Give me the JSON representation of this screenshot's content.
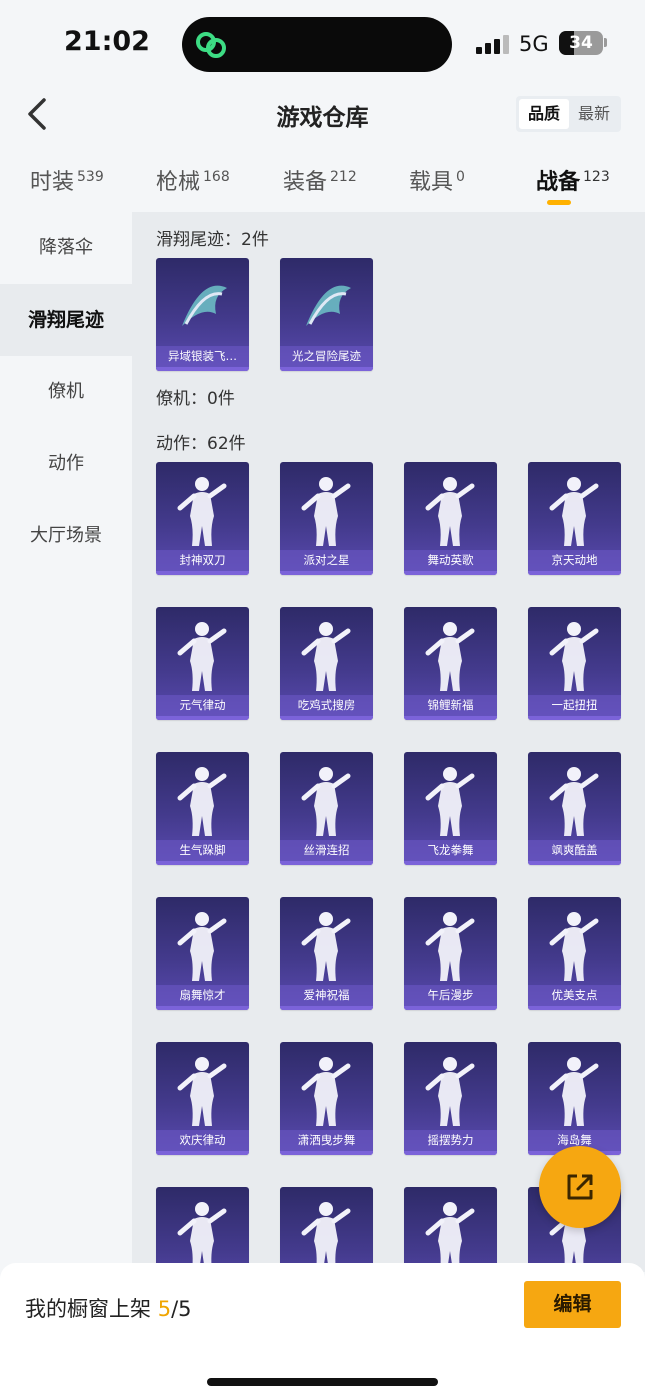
{
  "status": {
    "time": "21:02",
    "network": "5G",
    "battery": "34"
  },
  "header": {
    "title": "游戏仓库",
    "sort_quality": "品质",
    "sort_newest": "最新"
  },
  "tabs": [
    {
      "label": "时装",
      "count": "539"
    },
    {
      "label": "枪械",
      "count": "168"
    },
    {
      "label": "装备",
      "count": "212"
    },
    {
      "label": "载具",
      "count": "0"
    },
    {
      "label": "战备",
      "count": "123"
    }
  ],
  "sidebar": {
    "items": [
      {
        "label": "降落伞"
      },
      {
        "label": "滑翔尾迹"
      },
      {
        "label": "僚机"
      },
      {
        "label": "动作"
      },
      {
        "label": "大厅场景"
      }
    ]
  },
  "sections": {
    "trail": {
      "label": "滑翔尾迹：2件",
      "items": [
        "异域银装飞…",
        "光之冒险尾迹"
      ]
    },
    "wingman": {
      "label": "僚机：0件"
    },
    "emote": {
      "label": "动作：62件",
      "items": [
        "封神双刀",
        "派对之星",
        "舞动英歌",
        "京天动地",
        "元气律动",
        "吃鸡式搜房",
        "锦鲤新福",
        "一起扭扭",
        "生气跺脚",
        "丝滑连招",
        "飞龙拳舞",
        "飒爽酷盖",
        "扇舞惊才",
        "爱神祝福",
        "午后漫步",
        "优美支点",
        "欢庆律动",
        "潇洒曳步舞",
        "摇摆势力",
        "海岛舞"
      ]
    }
  },
  "bottom": {
    "window_label": "我的橱窗上架 ",
    "window_current": "5",
    "window_total": "/5",
    "edit_label": "编辑"
  },
  "colors": {
    "accent": "#f6a711",
    "card_top": "#2e2a68",
    "card_bottom": "#5a4ab0"
  },
  "icons": {
    "back": "chevron-left-icon",
    "share": "share-external-icon"
  }
}
